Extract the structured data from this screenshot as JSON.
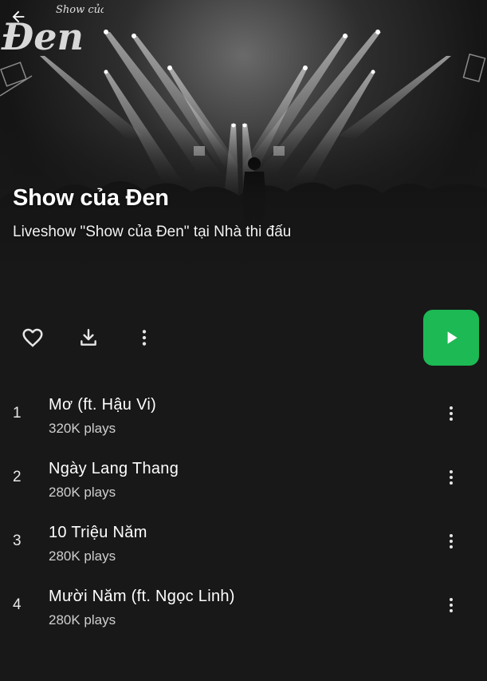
{
  "album": {
    "title": "Show của Đen",
    "subtitle": "Liveshow \"Show của Đen\" tại Nhà thi đấu",
    "logo_text_small": "Show của",
    "logo_text_big": "Đen"
  },
  "icons": {
    "back": "arrow-left-icon",
    "like": "heart-outline-icon",
    "download": "download-icon",
    "more": "more-vert-icon",
    "play": "play-icon"
  },
  "colors": {
    "background": "#181818",
    "accent": "#1db954",
    "text": "#ffffff",
    "secondary_text": "#cfcfcf"
  },
  "tracks": [
    {
      "number": "1",
      "title": "Mơ (ft. Hậu Vi)",
      "plays": "320K plays"
    },
    {
      "number": "2",
      "title": "Ngày Lang Thang",
      "plays": "280K plays"
    },
    {
      "number": "3",
      "title": "10 Triệu Năm",
      "plays": "280K plays"
    },
    {
      "number": "4",
      "title": "Mười Năm (ft. Ngọc Linh)",
      "plays": "280K plays"
    }
  ]
}
